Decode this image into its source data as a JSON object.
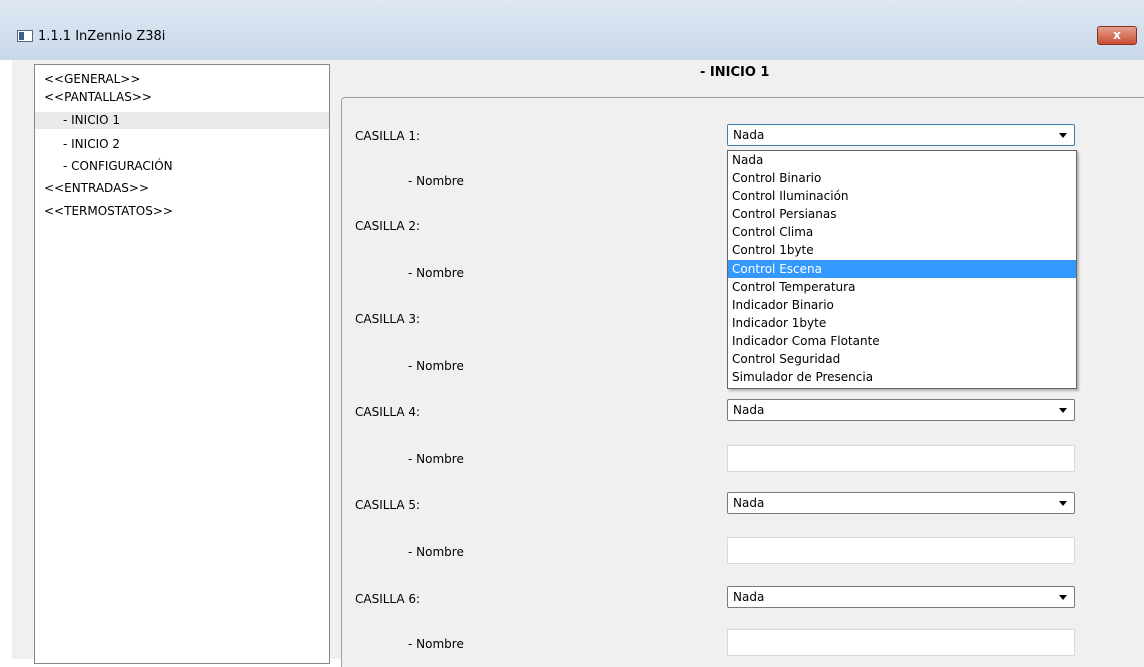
{
  "window": {
    "title": "1.1.1 InZennio Z38i",
    "close_label": "x"
  },
  "tree": {
    "items": [
      {
        "label": "<<GENERAL>>"
      },
      {
        "label": "<<PANTALLAS>>"
      },
      {
        "label": "- INICIO 1"
      },
      {
        "label": "- INICIO 2"
      },
      {
        "label": "- CONFIGURACIÓN"
      },
      {
        "label": "<<ENTRADAS>>"
      },
      {
        "label": "<<TERMOSTATOS>>"
      }
    ]
  },
  "panel": {
    "title": "- INICIO 1",
    "casillas": [
      {
        "label": "CASILLA 1:",
        "value": "Nada",
        "name_label": "- Nombre",
        "name_value": ""
      },
      {
        "label": "CASILLA 2:",
        "name_label": "- Nombre"
      },
      {
        "label": "CASILLA 3:",
        "name_label": "- Nombre"
      },
      {
        "label": "CASILLA 4:",
        "value": "Nada",
        "name_label": "- Nombre",
        "name_value": ""
      },
      {
        "label": "CASILLA 5:",
        "value": "Nada",
        "name_label": "- Nombre",
        "name_value": ""
      },
      {
        "label": "CASILLA 6:",
        "value": "Nada",
        "name_label": "- Nombre",
        "name_value": ""
      }
    ]
  },
  "dropdown": {
    "options": [
      "Nada",
      "Control Binario",
      "Control Iluminación",
      "Control Persianas",
      "Control Clima",
      "Control 1byte",
      "Control Escena",
      "Control Temperatura",
      "Indicador Binario",
      "Indicador 1byte",
      "Indicador Coma Flotante",
      "Control Seguridad",
      "Simulador de Presencia"
    ],
    "highlighted": "Control Escena"
  },
  "colors": {
    "highlight": "#3399ff",
    "close_button": "#c84d33"
  }
}
